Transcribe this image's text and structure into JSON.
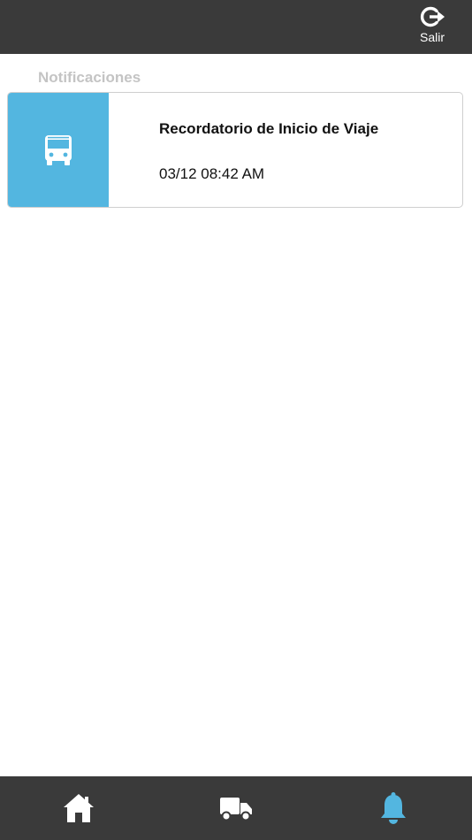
{
  "header": {
    "logout_label": "Salir",
    "logout_icon": "logout-icon"
  },
  "main": {
    "section_title": "Notificaciones",
    "notifications": [
      {
        "icon": "bus-icon",
        "title": "Recordatorio de Inicio de Viaje",
        "datetime": "03/12 08:42 AM"
      }
    ]
  },
  "bottom_nav": {
    "items": [
      {
        "icon": "home-icon",
        "active": false
      },
      {
        "icon": "truck-icon",
        "active": false
      },
      {
        "icon": "bell-icon",
        "active": true
      }
    ]
  },
  "colors": {
    "bar_background": "#3a3a3a",
    "accent": "#53b6e0",
    "nav_inactive": "#ffffff",
    "section_title": "#c4c4c4"
  }
}
